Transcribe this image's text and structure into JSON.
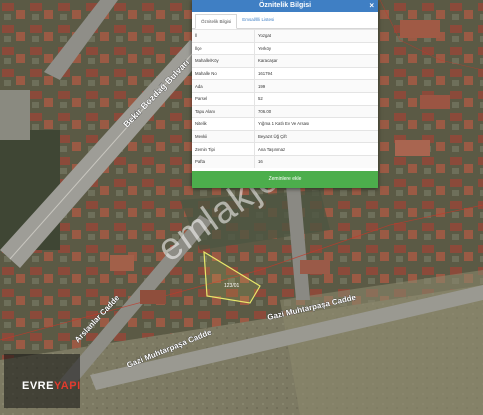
{
  "panel": {
    "title": "Öznitelik Bilgisi",
    "close": "×",
    "tabs": [
      {
        "label": "Öznitelik Bilgisi",
        "active": true
      },
      {
        "label": "Emsal/İlli Listesi",
        "active": false
      }
    ],
    "rows": [
      {
        "key": "İl",
        "value": "Yozgat"
      },
      {
        "key": "İlçe",
        "value": "Yerköy"
      },
      {
        "key": "Mahalle/Köy",
        "value": "Karacaşar"
      },
      {
        "key": "Mahalle No",
        "value": "161794"
      },
      {
        "key": "Ada",
        "value": "199"
      },
      {
        "key": "Parsel",
        "value": "52"
      },
      {
        "key": "Tapu Alanı",
        "value": "706.00"
      },
      {
        "key": "Nitelik",
        "value": "Yığma 1 Katlı Ev Ve Arsası"
      },
      {
        "key": "Mevkii",
        "value": "Beyazıt Üğ Çift"
      },
      {
        "key": "Zemin Tipi",
        "value": "Ana Taşınmaz"
      },
      {
        "key": "Pafta",
        "value": "16"
      }
    ],
    "action_label": "Zeminlere ekle"
  },
  "map": {
    "streets": [
      "Bekir Bozdağ Bulvarı",
      "Arslanlar Cadde",
      "Gazi Muhtarpaşa Cadde",
      "Gazi Muhtarpaşa Cadde"
    ],
    "parcel_label": "123/01",
    "watermark": "emlakjet.com",
    "parcel_color": "#e8e86a"
  },
  "logo": {
    "text_main": "EVRE",
    "text_accent": "YAPI",
    "accent_color": "#e23b2e"
  }
}
